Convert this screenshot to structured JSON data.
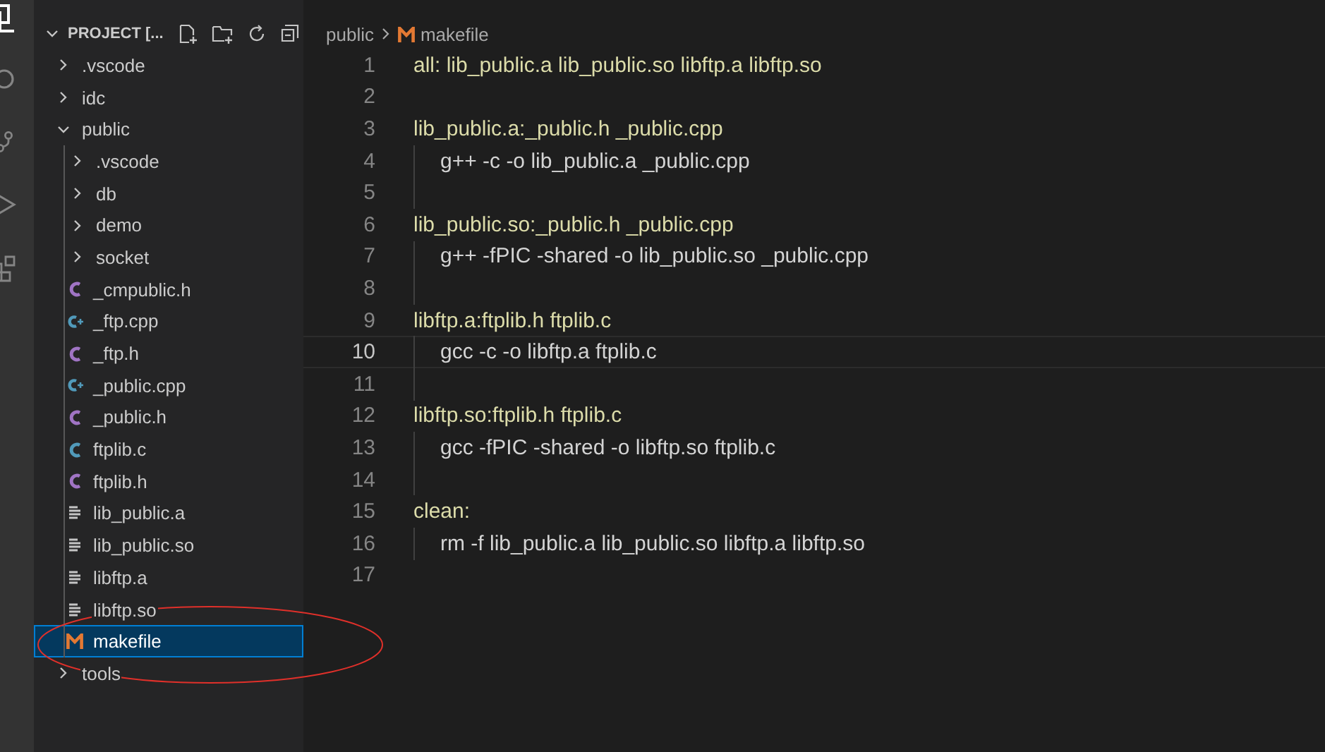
{
  "explorer": {
    "title": "PROJECT [...",
    "tree": [
      {
        "label": ".vscode",
        "kind": "folder",
        "expanded": false,
        "selected": false
      },
      {
        "label": "idc",
        "kind": "folder",
        "expanded": false,
        "selected": false
      },
      {
        "label": "public",
        "kind": "folder",
        "expanded": true,
        "selected": false,
        "children": [
          {
            "label": ".vscode",
            "kind": "folder",
            "expanded": false,
            "selected": false
          },
          {
            "label": "db",
            "kind": "folder",
            "expanded": false,
            "selected": false
          },
          {
            "label": "demo",
            "kind": "folder",
            "expanded": false,
            "selected": false
          },
          {
            "label": "socket",
            "kind": "folder",
            "expanded": false,
            "selected": false
          },
          {
            "label": "_cmpublic.h",
            "kind": "h",
            "selected": false
          },
          {
            "label": "_ftp.cpp",
            "kind": "cpp",
            "selected": false
          },
          {
            "label": "_ftp.h",
            "kind": "h",
            "selected": false
          },
          {
            "label": "_public.cpp",
            "kind": "cpp",
            "selected": false
          },
          {
            "label": "_public.h",
            "kind": "h",
            "selected": false
          },
          {
            "label": "ftplib.c",
            "kind": "c",
            "selected": false
          },
          {
            "label": "ftplib.h",
            "kind": "h",
            "selected": false
          },
          {
            "label": "lib_public.a",
            "kind": "binary",
            "selected": false
          },
          {
            "label": "lib_public.so",
            "kind": "binary",
            "selected": false
          },
          {
            "label": "libftp.a",
            "kind": "binary",
            "selected": false
          },
          {
            "label": "libftp.so",
            "kind": "binary",
            "selected": false
          },
          {
            "label": "makefile",
            "kind": "makefile",
            "selected": true
          }
        ]
      },
      {
        "label": "tools",
        "kind": "folder",
        "expanded": false,
        "selected": false
      }
    ]
  },
  "editor": {
    "breadcrumb": {
      "folder": "public",
      "file": "makefile"
    },
    "lines": [
      {
        "number": "1",
        "kind": "target",
        "text": "all: lib_public.a lib_public.so libftp.a libftp.so",
        "current": false
      },
      {
        "number": "2",
        "kind": "blank",
        "current": false
      },
      {
        "number": "3",
        "kind": "target",
        "text": "lib_public.a:_public.h _public.cpp",
        "current": false
      },
      {
        "number": "4",
        "kind": "recipe",
        "text": "g++ -c -o lib_public.a _public.cpp",
        "current": false
      },
      {
        "number": "5",
        "kind": "indent",
        "current": false
      },
      {
        "number": "6",
        "kind": "target",
        "text": "lib_public.so:_public.h _public.cpp",
        "current": false
      },
      {
        "number": "7",
        "kind": "recipe",
        "text": "g++ -fPIC -shared -o lib_public.so _public.cpp",
        "current": false
      },
      {
        "number": "8",
        "kind": "indent",
        "current": false
      },
      {
        "number": "9",
        "kind": "target",
        "text": "libftp.a:ftplib.h ftplib.c",
        "current": false
      },
      {
        "number": "10",
        "kind": "recipe",
        "text": "gcc -c -o libftp.a ftplib.c",
        "current": true
      },
      {
        "number": "11",
        "kind": "indent",
        "current": false
      },
      {
        "number": "12",
        "kind": "target",
        "text": "libftp.so:ftplib.h ftplib.c",
        "current": false
      },
      {
        "number": "13",
        "kind": "recipe",
        "text": "gcc -fPIC -shared -o libftp.so ftplib.c",
        "current": false
      },
      {
        "number": "14",
        "kind": "indent",
        "current": false
      },
      {
        "number": "15",
        "kind": "target",
        "text": "clean:",
        "current": false
      },
      {
        "number": "16",
        "kind": "recipe",
        "text": "rm -f lib_public.a lib_public.so libftp.a libftp.so",
        "current": false
      },
      {
        "number": "17",
        "kind": "blank",
        "current": false
      }
    ]
  }
}
